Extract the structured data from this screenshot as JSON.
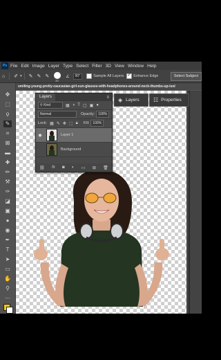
{
  "menubar": {
    "logo": "Ps",
    "items": [
      "File",
      "Edit",
      "Image",
      "Layer",
      "Type",
      "Select",
      "Filter",
      "3D",
      "View",
      "Window",
      "Help"
    ]
  },
  "options_bar": {
    "brush_size": "20",
    "angle": "90°",
    "sample_all_layers": "Sample All Layers",
    "enhance_edge": "Enhance Edge",
    "select_subject": "Select Subject"
  },
  "document_tab": {
    "title": "smiling-young-pretty-caucasian-girl-sun-glasses-with-headphones-around-neck-thumbs-up-isol"
  },
  "panels": {
    "layers_button": "Layers",
    "properties_button": "Properties"
  },
  "layers_panel": {
    "tab": "Layers",
    "filter_kind": "Kind",
    "blend_mode": "Normal",
    "opacity_label": "Opacity:",
    "opacity_value": "100%",
    "lock_label": "Lock:",
    "fill_label": "Fill:",
    "fill_value": "100%",
    "layers": [
      {
        "name": "Layer 1",
        "visible": true,
        "selected": true
      },
      {
        "name": "Background",
        "visible": false,
        "selected": false
      }
    ],
    "footer_icons": [
      "link-icon",
      "fx-icon",
      "mask-icon",
      "adjustment-icon",
      "folder-icon",
      "new-layer-icon",
      "trash-icon"
    ]
  },
  "colors": {
    "foreground": "#f4c51a",
    "background": "#ffffff",
    "accent": "#31a8ff"
  }
}
